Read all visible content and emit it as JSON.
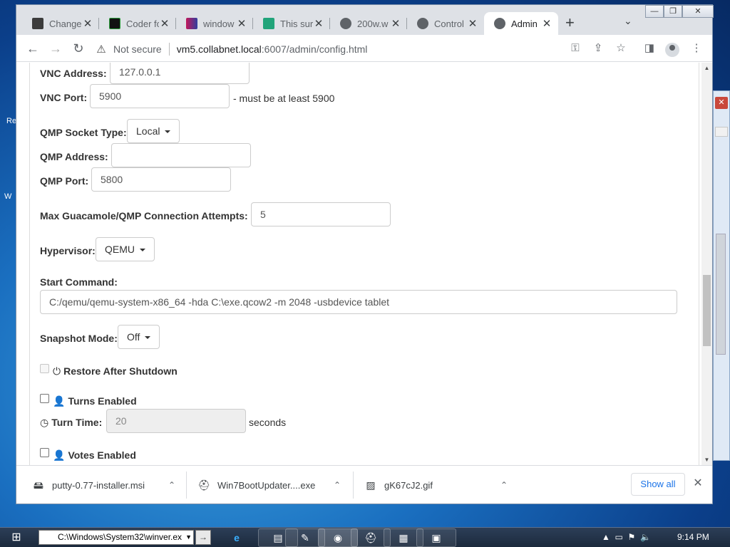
{
  "desktop": {
    "label_a": "Re",
    "label_b": "W"
  },
  "window_controls": {
    "minimize": "—",
    "restore": "❐",
    "close": "✕"
  },
  "tabs": [
    {
      "label": "Change",
      "favicon_color": "#3c3c3c"
    },
    {
      "label": "Coder fo",
      "favicon_color": "#111111"
    },
    {
      "label": "window",
      "favicon_color": "#7a3b8f"
    },
    {
      "label": "This sur",
      "favicon_color": "#21a47a"
    },
    {
      "label": "200w.w",
      "favicon_color": "#5f6368"
    },
    {
      "label": "Control",
      "favicon_color": "#5f6368"
    },
    {
      "label": "Admin",
      "favicon_color": "#5f6368"
    }
  ],
  "toolbar": {
    "not_secure": "Not secure",
    "url_host": "vm5.collabnet.local",
    "url_path": ":6007/admin/config.html"
  },
  "form": {
    "vnc_address_label": "VNC Address:",
    "vnc_address_value": "127.0.0.1",
    "vnc_port_label": "VNC Port:",
    "vnc_port_value": "5900",
    "vnc_port_hint": "- must be at least 5900",
    "qmp_socket_label": "QMP Socket Type:",
    "qmp_socket_value": "Local",
    "qmp_address_label": "QMP Address:",
    "qmp_address_value": "",
    "qmp_port_label": "QMP Port:",
    "qmp_port_value": "5800",
    "max_attempts_label": "Max Guacamole/QMP Connection Attempts:",
    "max_attempts_value": "5",
    "hypervisor_label": "Hypervisor:",
    "hypervisor_value": "QEMU",
    "start_command_label": "Start Command:",
    "start_command_value": "C:/qemu/qemu-system-x86_64 -hda C:\\exe.qcow2 -m 2048 -usbdevice tablet",
    "snapshot_label": "Snapshot Mode:",
    "snapshot_value": "Off",
    "restore_label": "Restore After Shutdown",
    "restore_checked": false,
    "turns_label": "Turns Enabled",
    "turns_checked": false,
    "turn_time_label": "Turn Time:",
    "turn_time_value": "20",
    "turn_time_unit": "seconds",
    "votes_label": "Votes Enabled",
    "votes_checked": false
  },
  "downloads": {
    "items": [
      {
        "name": "putty-0.77-installer.msi",
        "icon": "msi-icon"
      },
      {
        "name": "Win7BootUpdater....exe",
        "icon": "exe-icon"
      },
      {
        "name": "gK67cJ2.gif",
        "icon": "image-icon"
      }
    ],
    "show_all": "Show all"
  },
  "taskbar": {
    "run_value": "C:\\Windows\\System32\\winver.ex",
    "clock": "9:14 PM"
  }
}
